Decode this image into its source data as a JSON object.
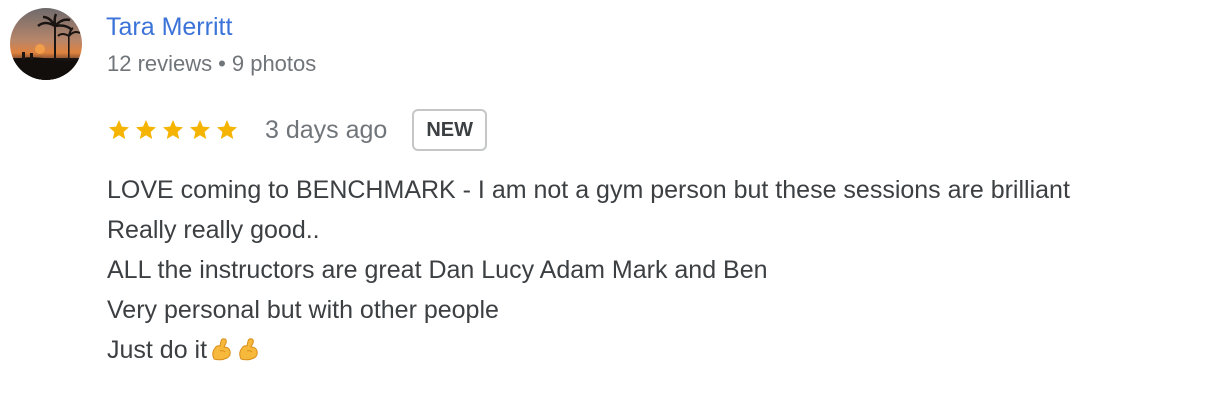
{
  "reviewer": {
    "name": "Tara Merritt",
    "reviews": "12 reviews",
    "separator": "•",
    "photos": "9 photos"
  },
  "review": {
    "rating": 5,
    "max_rating": 5,
    "star_color": "#f4b400",
    "date": "3 days ago",
    "badge": "NEW",
    "lines": [
      "LOVE coming to BENCHMARK - I am not a gym person but these sessions are brilliant",
      "Really really good..",
      "ALL the instructors are great Dan Lucy Adam Mark and Ben",
      "Very personal but with other people",
      "Just do it💪💪"
    ],
    "last_line_text": "Just do it",
    "emoji": [
      "flexed-biceps",
      "flexed-biceps"
    ]
  },
  "colors": {
    "name_link": "#3b73d8",
    "secondary_text": "#70757a",
    "body_text": "#3c4043"
  }
}
